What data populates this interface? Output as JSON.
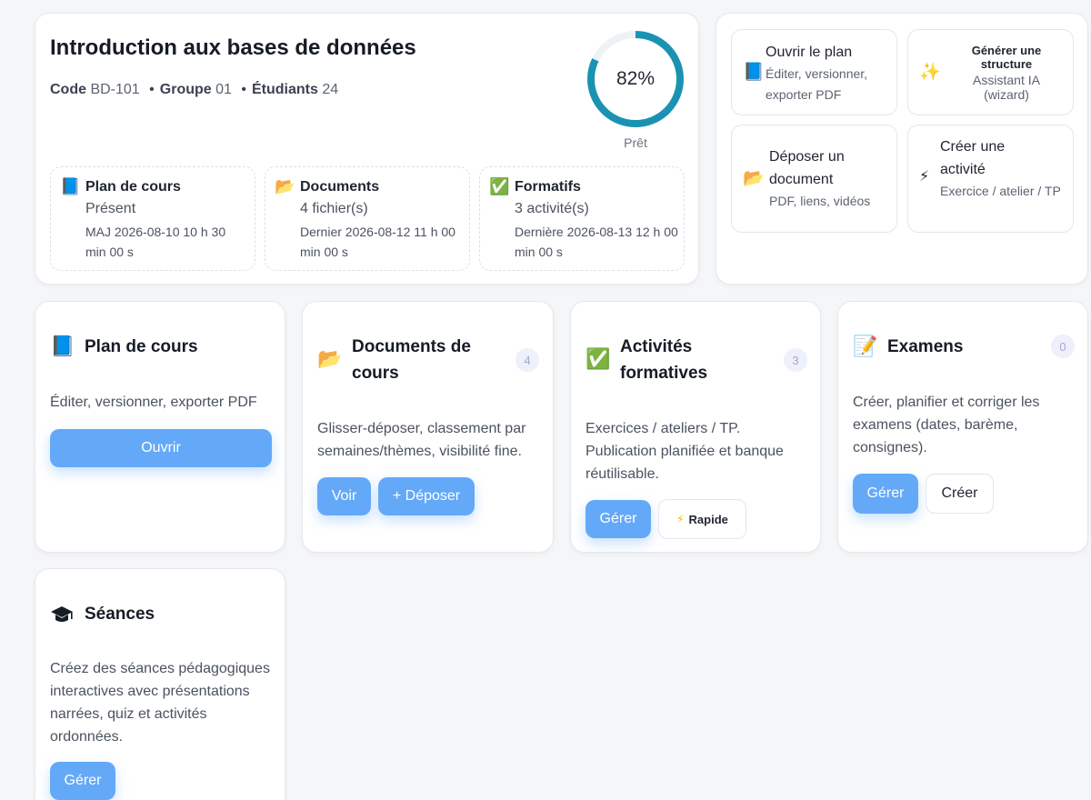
{
  "course": {
    "title": "Introduction aux bases de données",
    "code_label": "Code",
    "code": "BD-101",
    "group_label": "Groupe",
    "group": "01",
    "students_label": "Étudiants",
    "students": "24",
    "separator": "•",
    "progress": {
      "value": 0.82,
      "label": "82%",
      "status": "Prêt",
      "color": "#1a93b3"
    }
  },
  "summary": [
    {
      "icon": "📘",
      "icon_name": "blue-book-icon",
      "title": "Plan de cours",
      "value": "Présent",
      "detail": "MAJ 2026-08-10 10 h 30 min 00 s"
    },
    {
      "icon": "📂",
      "icon_name": "open-folder-icon",
      "title": "Documents",
      "value": "4 fichier(s)",
      "detail": "Dernier 2026-08-12 11 h 00 min 00 s"
    },
    {
      "icon": "✅",
      "icon_name": "check-mark-icon",
      "title": "Formatifs",
      "value": "3 activité(s)",
      "detail": "Dernière 2026-08-13 12 h 00 min 00 s"
    }
  ],
  "quick_actions": [
    {
      "icon": "📘",
      "icon_name": "blue-book-icon",
      "title": "Ouvrir le plan",
      "subtitle": "Éditer, versionner, exporter PDF"
    },
    {
      "icon": "✨",
      "icon_name": "sparkles-icon",
      "title": "Générer une structure",
      "subtitle": "Assistant IA (wizard)"
    },
    {
      "icon": "📂",
      "icon_name": "open-folder-icon",
      "title": "Déposer un document",
      "subtitle": "PDF, liens, vidéos"
    },
    {
      "icon": "⚡",
      "icon_name": "lightning-icon",
      "title": "Créer une activité",
      "subtitle": "Exercice / atelier / TP"
    }
  ],
  "sections": {
    "plan": {
      "icon": "📘",
      "title": "Plan de cours",
      "description": "Éditer, versionner, exporter PDF",
      "open_label": "Ouvrir"
    },
    "documents": {
      "icon": "📂",
      "title": "Documents de cours",
      "count": "4",
      "description": "Glisser-déposer, classement par semaines/thèmes, visibilité fine.",
      "view_label": "Voir",
      "upload_label": "+ Déposer"
    },
    "activities": {
      "icon": "✅",
      "title": "Activités formatives",
      "count": "3",
      "description": "Exercices / ateliers / TP. Publication planifiée et banque réutilisable.",
      "manage_label": "Gérer",
      "quick_icon": "⚡",
      "quick_label": "Rapide"
    },
    "exams": {
      "icon": "📝",
      "title": "Examens",
      "count": "0",
      "description": "Créer, planifier et corriger les examens (dates, barème, consignes).",
      "manage_label": "Gérer",
      "create_label": "Créer"
    },
    "sessions": {
      "title": "Séances",
      "description": "Créez des séances pédagogiques interactives avec présentations narrées, quiz et activités ordonnées.",
      "manage_label": "Gérer"
    }
  },
  "colors": {
    "accent": "#64a9f8",
    "ring": "#1a93b3",
    "badge_bg": "#eef0fb"
  }
}
